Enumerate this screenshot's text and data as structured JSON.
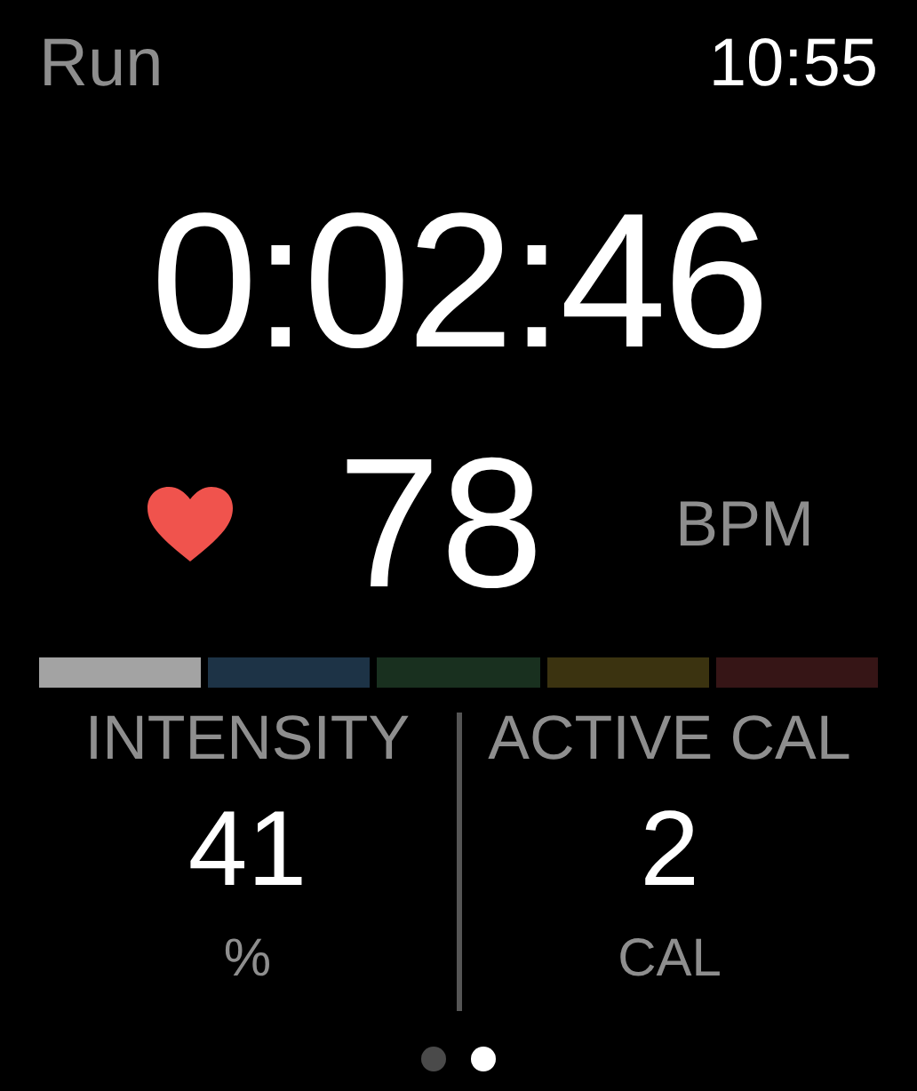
{
  "header": {
    "title": "Run",
    "time": "10:55"
  },
  "elapsed": "0:02:46",
  "heart_rate": {
    "value": "78",
    "unit": "BPM"
  },
  "zones": [
    {
      "color": "#a3a3a3"
    },
    {
      "color": "#1d3346"
    },
    {
      "color": "#19301f"
    },
    {
      "color": "#3b3310"
    },
    {
      "color": "#361516"
    }
  ],
  "metrics": [
    {
      "label": "INTENSITY",
      "value": "41",
      "unit": "%"
    },
    {
      "label": "ACTIVE CAL",
      "value": "2",
      "unit": "CAL"
    }
  ],
  "pages": [
    {
      "selected": false
    },
    {
      "selected": true
    }
  ]
}
